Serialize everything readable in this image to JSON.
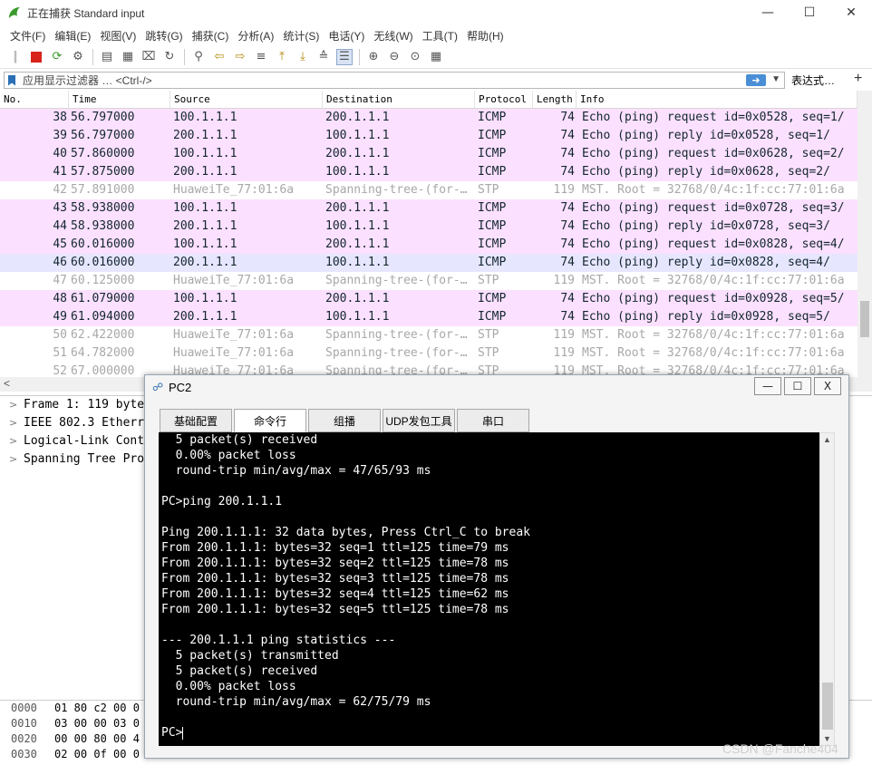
{
  "wireshark": {
    "title": "正在捕获 Standard input",
    "menu": [
      "文件(F)",
      "编辑(E)",
      "视图(V)",
      "跳转(G)",
      "捕获(C)",
      "分析(A)",
      "统计(S)",
      "电话(Y)",
      "无线(W)",
      "工具(T)",
      "帮助(H)"
    ],
    "filter_placeholder": "应用显示过滤器 … <Ctrl-/>",
    "expression_label": "表达式…",
    "plus_label": "+",
    "columns": [
      "No.",
      "Time",
      "Source",
      "Destination",
      "Protocol",
      "Length",
      "Info"
    ],
    "packets": [
      {
        "no": "38",
        "time": "56.797000",
        "src": "100.1.1.1",
        "dst": "200.1.1.1",
        "proto": "ICMP",
        "len": "74",
        "info": "Echo (ping) request  id=0x0528, seq=1/",
        "kind": "icmp"
      },
      {
        "no": "39",
        "time": "56.797000",
        "src": "200.1.1.1",
        "dst": "100.1.1.1",
        "proto": "ICMP",
        "len": "74",
        "info": "Echo (ping) reply    id=0x0528, seq=1/",
        "kind": "icmp"
      },
      {
        "no": "40",
        "time": "57.860000",
        "src": "100.1.1.1",
        "dst": "200.1.1.1",
        "proto": "ICMP",
        "len": "74",
        "info": "Echo (ping) request  id=0x0628, seq=2/",
        "kind": "icmp"
      },
      {
        "no": "41",
        "time": "57.875000",
        "src": "200.1.1.1",
        "dst": "100.1.1.1",
        "proto": "ICMP",
        "len": "74",
        "info": "Echo (ping) reply    id=0x0628, seq=2/",
        "kind": "icmp"
      },
      {
        "no": "42",
        "time": "57.891000",
        "src": "HuaweiTe_77:01:6a",
        "dst": "Spanning-tree-(for-…",
        "proto": "STP",
        "len": "119",
        "info": "MST. Root = 32768/0/4c:1f:cc:77:01:6a",
        "kind": "stp"
      },
      {
        "no": "43",
        "time": "58.938000",
        "src": "100.1.1.1",
        "dst": "200.1.1.1",
        "proto": "ICMP",
        "len": "74",
        "info": "Echo (ping) request  id=0x0728, seq=3/",
        "kind": "icmp"
      },
      {
        "no": "44",
        "time": "58.938000",
        "src": "200.1.1.1",
        "dst": "100.1.1.1",
        "proto": "ICMP",
        "len": "74",
        "info": "Echo (ping) reply    id=0x0728, seq=3/",
        "kind": "icmp"
      },
      {
        "no": "45",
        "time": "60.016000",
        "src": "100.1.1.1",
        "dst": "200.1.1.1",
        "proto": "ICMP",
        "len": "74",
        "info": "Echo (ping) request  id=0x0828, seq=4/",
        "kind": "icmp"
      },
      {
        "no": "46",
        "time": "60.016000",
        "src": "200.1.1.1",
        "dst": "100.1.1.1",
        "proto": "ICMP",
        "len": "74",
        "info": "Echo (ping) reply    id=0x0828, seq=4/",
        "kind": "sel"
      },
      {
        "no": "47",
        "time": "60.125000",
        "src": "HuaweiTe_77:01:6a",
        "dst": "Spanning-tree-(for-…",
        "proto": "STP",
        "len": "119",
        "info": "MST. Root = 32768/0/4c:1f:cc:77:01:6a",
        "kind": "stp"
      },
      {
        "no": "48",
        "time": "61.079000",
        "src": "100.1.1.1",
        "dst": "200.1.1.1",
        "proto": "ICMP",
        "len": "74",
        "info": "Echo (ping) request  id=0x0928, seq=5/",
        "kind": "icmp"
      },
      {
        "no": "49",
        "time": "61.094000",
        "src": "200.1.1.1",
        "dst": "100.1.1.1",
        "proto": "ICMP",
        "len": "74",
        "info": "Echo (ping) reply    id=0x0928, seq=5/",
        "kind": "icmp"
      },
      {
        "no": "50",
        "time": "62.422000",
        "src": "HuaweiTe_77:01:6a",
        "dst": "Spanning-tree-(for-…",
        "proto": "STP",
        "len": "119",
        "info": "MST. Root = 32768/0/4c:1f:cc:77:01:6a",
        "kind": "stp"
      },
      {
        "no": "51",
        "time": "64.782000",
        "src": "HuaweiTe_77:01:6a",
        "dst": "Spanning-tree-(for-…",
        "proto": "STP",
        "len": "119",
        "info": "MST. Root = 32768/0/4c:1f:cc:77:01:6a",
        "kind": "stp"
      },
      {
        "no": "52",
        "time": "67.000000",
        "src": "HuaweiTe_77:01:6a",
        "dst": "Spanning-tree-(for-…",
        "proto": "STP",
        "len": "119",
        "info": "MST. Root = 32768/0/4c:1f:cc:77:01:6a",
        "kind": "stp"
      }
    ],
    "details": [
      "Frame 1: 119 byte",
      "IEEE 802.3 Etherr",
      "Logical-Link Cont",
      "Spanning Tree Pro"
    ],
    "bytes": [
      {
        "off": "0000",
        "hex": "01 80 c2 00 0"
      },
      {
        "off": "0010",
        "hex": "03 00 00 03 0"
      },
      {
        "off": "0020",
        "hex": "00 00 80 00 4"
      },
      {
        "off": "0030",
        "hex": "02 00 0f 00 0"
      }
    ]
  },
  "pc2": {
    "title": "PC2",
    "tabs": [
      "基础配置",
      "命令行",
      "组播",
      "UDP发包工具",
      "串口"
    ],
    "active_tab": "命令行",
    "terminal_lines": [
      "  5 packet(s) received",
      "  0.00% packet loss",
      "  round-trip min/avg/max = 47/65/93 ms",
      "",
      "PC>ping 200.1.1.1",
      "",
      "Ping 200.1.1.1: 32 data bytes, Press Ctrl_C to break",
      "From 200.1.1.1: bytes=32 seq=1 ttl=125 time=79 ms",
      "From 200.1.1.1: bytes=32 seq=2 ttl=125 time=78 ms",
      "From 200.1.1.1: bytes=32 seq=3 ttl=125 time=78 ms",
      "From 200.1.1.1: bytes=32 seq=4 ttl=125 time=62 ms",
      "From 200.1.1.1: bytes=32 seq=5 ttl=125 time=78 ms",
      "",
      "--- 200.1.1.1 ping statistics ---",
      "  5 packet(s) transmitted",
      "  5 packet(s) received",
      "  0.00% packet loss",
      "  round-trip min/avg/max = 62/75/79 ms",
      ""
    ],
    "prompt": "PC>"
  },
  "watermark": "CSDN @Fanche404",
  "colors": {
    "icmp_row": "#fce0ff",
    "stp_row": "#ffffff",
    "selected_row": "#e7e6ff",
    "terminal_bg": "#000000"
  }
}
